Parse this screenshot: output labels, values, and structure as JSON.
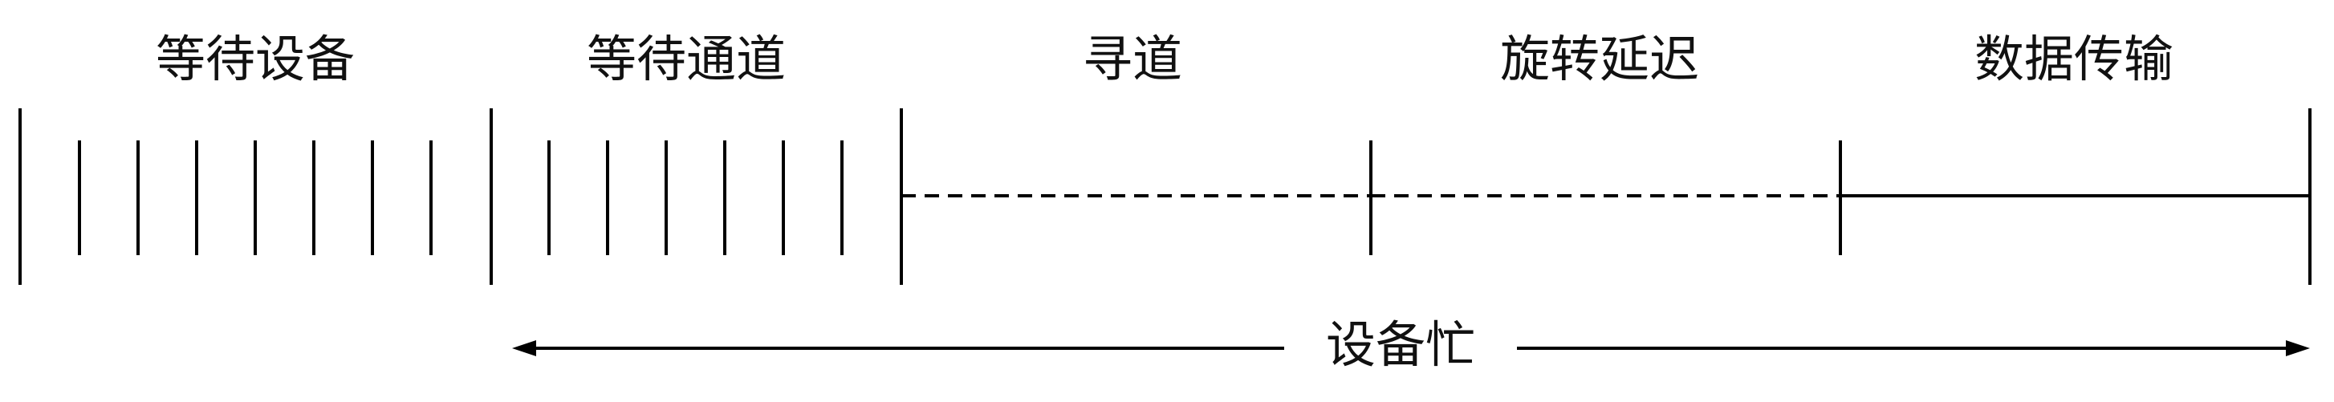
{
  "segments": [
    {
      "label": "等待设备"
    },
    {
      "label": "等待通道"
    },
    {
      "label": "寻道"
    },
    {
      "label": "旋转延迟"
    },
    {
      "label": "数据传输"
    }
  ],
  "busy_span": {
    "label": "设备忙"
  },
  "colors": {
    "line": "#000000",
    "text": "#111111",
    "background": "#ffffff"
  }
}
